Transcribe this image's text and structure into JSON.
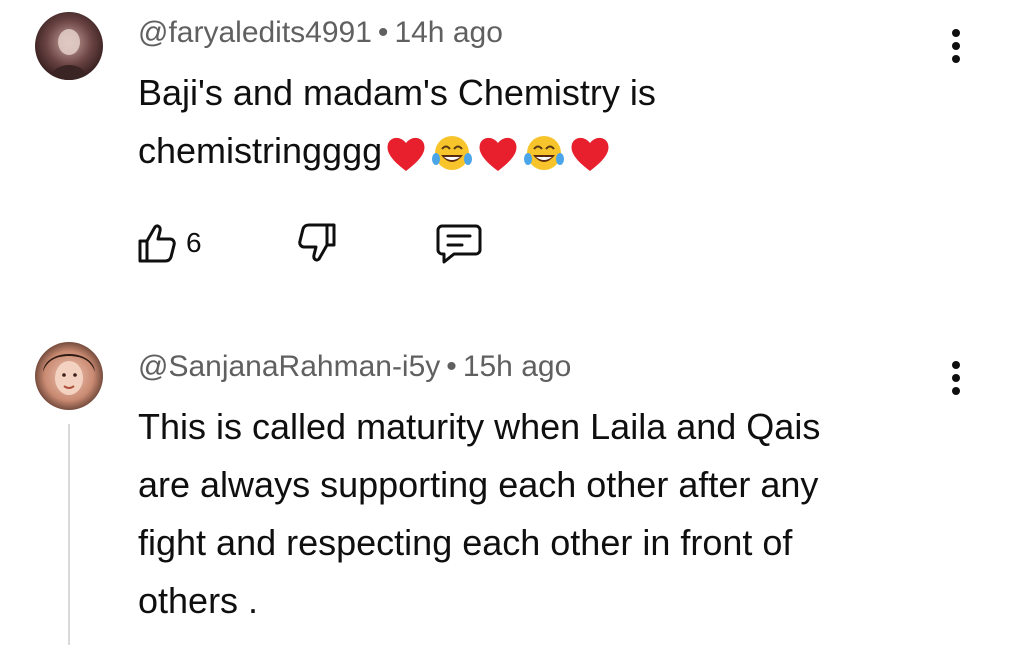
{
  "comments": [
    {
      "author": "@faryaledits4991",
      "separator": "•",
      "time": "14h ago",
      "lines": [
        "Baji's and madam's Chemistry is",
        "chemistringggg"
      ],
      "emojis": [
        "red-heart",
        "tears-of-joy",
        "red-heart",
        "tears-of-joy",
        "red-heart"
      ],
      "likes": "6",
      "avatar_color": "#5a3a3a"
    },
    {
      "author": "@SanjanaRahman-i5y",
      "separator": "•",
      "time": "15h ago",
      "lines": [
        "This is called maturity when Laila and Qais",
        "are always supporting each other after any",
        "fight and respecting each other in front of",
        "others ."
      ],
      "avatar_color": "#8a5a4a"
    }
  ],
  "icons": {
    "like": "thumbs-up-icon",
    "dislike": "thumbs-down-icon",
    "reply": "reply-icon",
    "more": "more-vertical-icon"
  },
  "colors": {
    "text": "#0f0f0f",
    "meta": "#606060",
    "heart": "#e8202e",
    "emoji_yellow": "#f7c52b",
    "thread_line": "#d9d9d9"
  }
}
